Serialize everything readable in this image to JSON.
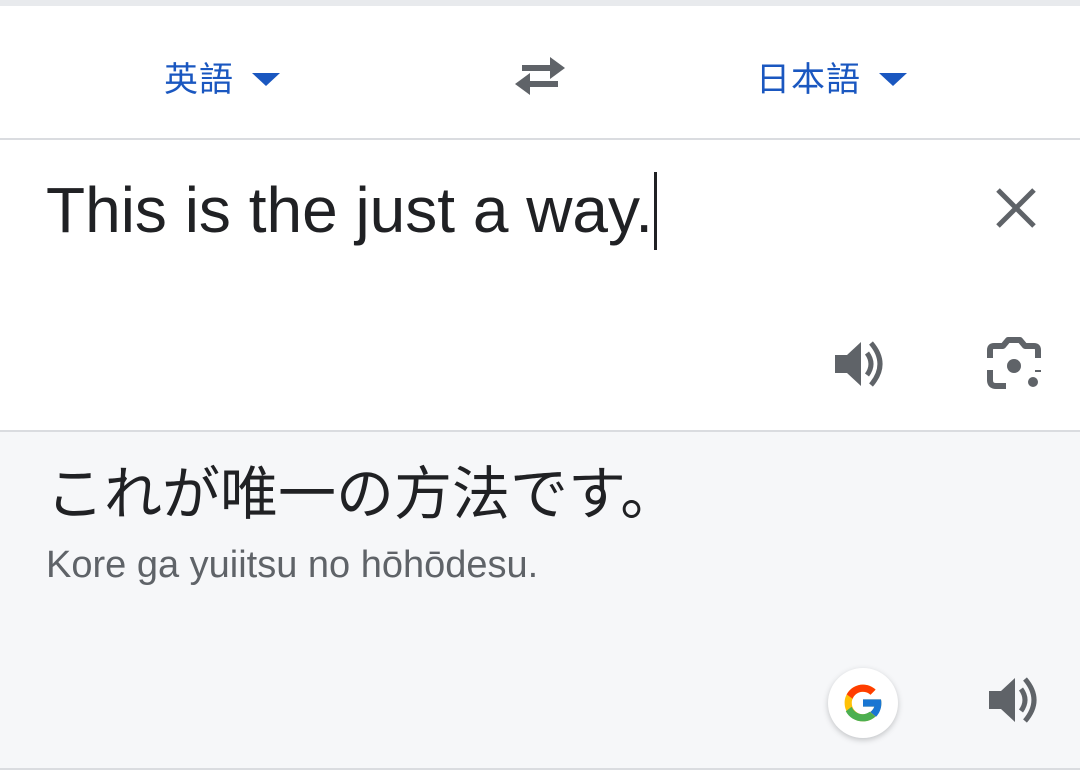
{
  "colors": {
    "accent": "#1a57c0",
    "text_primary": "#202124",
    "text_secondary": "#5f6368",
    "icon": "#5f6368",
    "output_background": "#f6f7f9"
  },
  "language_bar": {
    "source_language": "英語",
    "target_language": "日本語",
    "swap_icon": "swap-horiz-icon",
    "dropdown_icon": "arrow-drop-down-icon"
  },
  "input": {
    "text": "This is the just a way.",
    "clear_icon": "close-icon",
    "speak_icon": "volume-up-icon",
    "camera_icon": "camera-lens-icon"
  },
  "output": {
    "translation": "これが唯一の方法です。",
    "romanization": "Kore ga yuiitsu no hōhōdesu.",
    "google_icon": "google-g-icon",
    "speak_icon": "volume-up-icon"
  }
}
